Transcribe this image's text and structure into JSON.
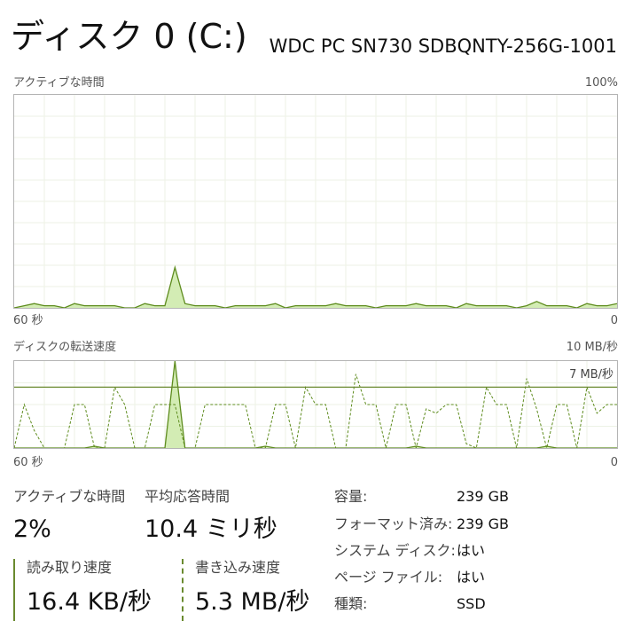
{
  "header": {
    "title": "ディスク 0 (C:)",
    "model": "WDC PC SN730 SDBQNTY-256G-1001"
  },
  "active_chart": {
    "label": "アクティブな時間",
    "max_label": "100%",
    "x_left_label": "60 秒",
    "x_right_label": "0"
  },
  "transfer_chart": {
    "label": "ディスクの転送速度",
    "max_label": "10 MB/秒",
    "ref_label": "7 MB/秒",
    "x_left_label": "60 秒",
    "x_right_label": "0"
  },
  "chart_data": [
    {
      "type": "area",
      "ylim": [
        0,
        100
      ],
      "grid": true,
      "x": [
        60,
        59,
        58,
        57,
        56,
        55,
        54,
        53,
        52,
        51,
        50,
        49,
        48,
        47,
        46,
        45,
        44,
        43,
        42,
        41,
        40,
        39,
        38,
        37,
        36,
        35,
        34,
        33,
        32,
        31,
        30,
        29,
        28,
        27,
        26,
        25,
        24,
        23,
        22,
        21,
        20,
        19,
        18,
        17,
        16,
        15,
        14,
        13,
        12,
        11,
        10,
        9,
        8,
        7,
        6,
        5,
        4,
        3,
        2,
        1,
        0
      ],
      "series": [
        {
          "values": [
            0,
            1,
            2,
            1,
            1,
            0,
            2,
            1,
            1,
            1,
            1,
            0,
            0,
            2,
            1,
            1,
            19,
            2,
            1,
            1,
            1,
            0,
            1,
            1,
            1,
            1,
            2,
            0,
            1,
            1,
            1,
            1,
            2,
            1,
            1,
            1,
            0,
            1,
            1,
            1,
            2,
            1,
            1,
            1,
            0,
            2,
            1,
            1,
            1,
            1,
            0,
            1,
            3,
            1,
            1,
            1,
            0,
            2,
            1,
            1,
            2
          ]
        }
      ]
    },
    {
      "type": "area",
      "ylim": [
        0,
        10
      ],
      "reference_line": 7,
      "grid": true,
      "x": [
        60,
        59,
        58,
        57,
        56,
        55,
        54,
        53,
        52,
        51,
        50,
        49,
        48,
        47,
        46,
        45,
        44,
        43,
        42,
        41,
        40,
        39,
        38,
        37,
        36,
        35,
        34,
        33,
        32,
        31,
        30,
        29,
        28,
        27,
        26,
        25,
        24,
        23,
        22,
        21,
        20,
        19,
        18,
        17,
        16,
        15,
        14,
        13,
        12,
        11,
        10,
        9,
        8,
        7,
        6,
        5,
        4,
        3,
        2,
        1,
        0
      ],
      "series": [
        {
          "name": "読み取り速度",
          "values": [
            0,
            0,
            0,
            0,
            0,
            0,
            0,
            0,
            0.2,
            0,
            0,
            0,
            0,
            0,
            0,
            0,
            10,
            0,
            0,
            0,
            0,
            0,
            0,
            0,
            0,
            0.2,
            0,
            0,
            0,
            0,
            0,
            0,
            0,
            0,
            0,
            0,
            0,
            0,
            0,
            0,
            0.2,
            0,
            0,
            0,
            0,
            0,
            0,
            0,
            0,
            0,
            0,
            0,
            0,
            0.2,
            0,
            0,
            0,
            0,
            0,
            0,
            0
          ]
        },
        {
          "name": "書き込み速度",
          "values": [
            0,
            5,
            2,
            0,
            0,
            0,
            5,
            5,
            0,
            0,
            7,
            5,
            0,
            0,
            5,
            5,
            5,
            0,
            0,
            5,
            5,
            5,
            5,
            5,
            0,
            0,
            5,
            5,
            0,
            7,
            5,
            5,
            0,
            0,
            8.5,
            5,
            5,
            0,
            5,
            5,
            0,
            4.5,
            4,
            5,
            5,
            0.5,
            0,
            7,
            5,
            5,
            0,
            8,
            4.5,
            0,
            5,
            5,
            0,
            7,
            4,
            5,
            5
          ]
        }
      ]
    }
  ],
  "stats": {
    "active_time": {
      "label": "アクティブな時間",
      "value": "2%"
    },
    "avg_response": {
      "label": "平均応答時間",
      "value": "10.4 ミリ秒"
    },
    "read_speed": {
      "label": "読み取り速度",
      "value": "16.4 KB/秒"
    },
    "write_speed": {
      "label": "書き込み速度",
      "value": "5.3 MB/秒"
    }
  },
  "properties": [
    {
      "label": "容量:",
      "value": "239 GB"
    },
    {
      "label": "フォーマット済み:",
      "value": "239 GB"
    },
    {
      "label": "システム ディスク:",
      "value": "はい"
    },
    {
      "label": "ページ ファイル:",
      "value": "はい"
    },
    {
      "label": "種類:",
      "value": "SSD"
    }
  ],
  "colors": {
    "line": "#5e8c1e",
    "fill": "#d3ecb4",
    "grid": "#edf2e6",
    "border": "#b4b4b4",
    "ref_line": "#6a8a2f"
  }
}
